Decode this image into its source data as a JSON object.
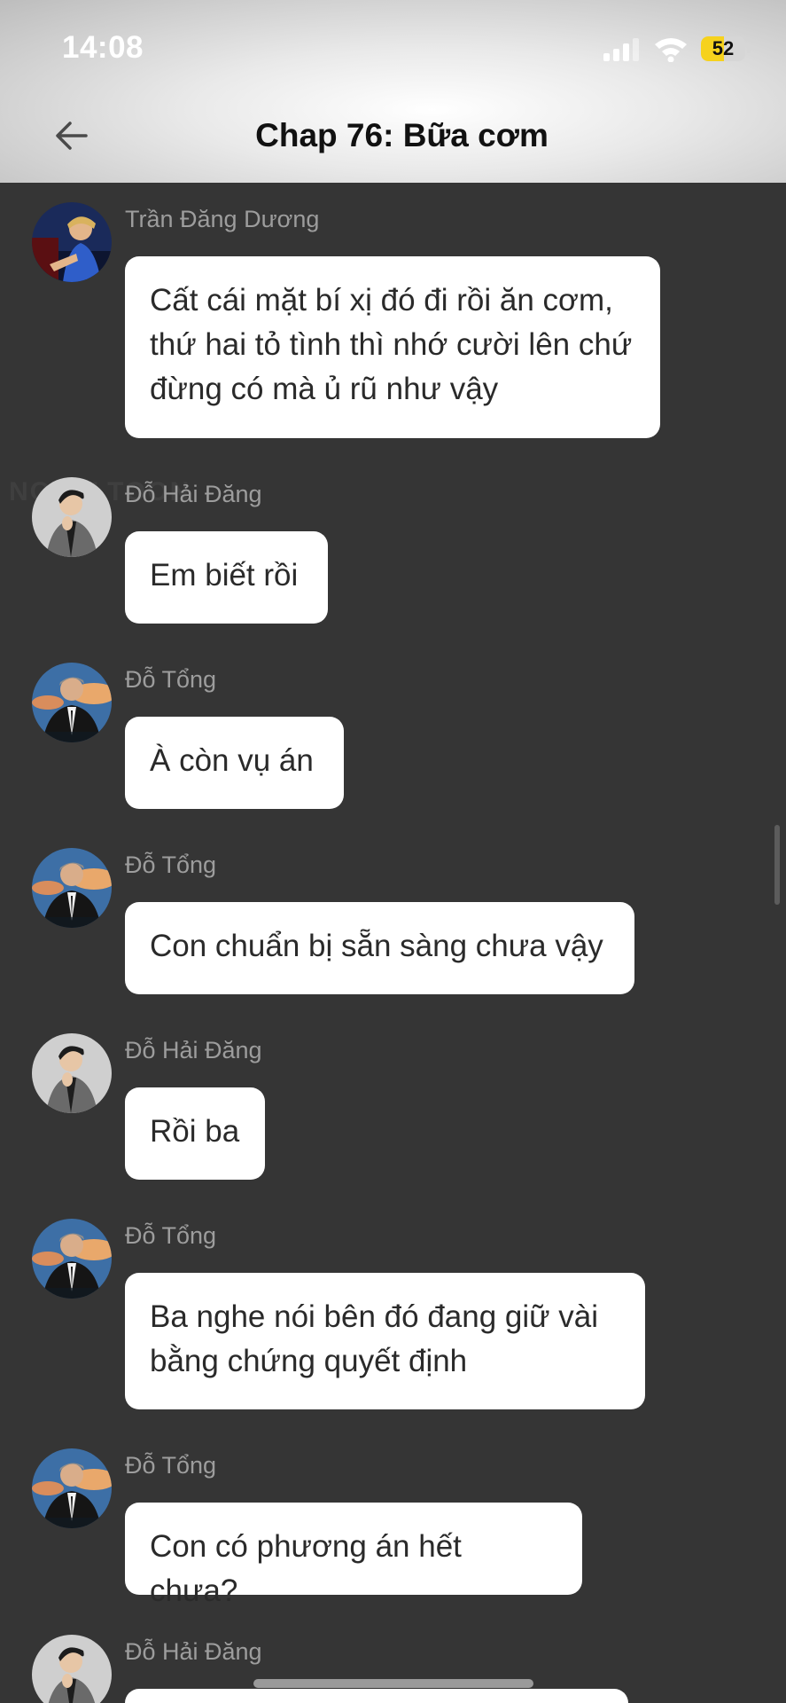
{
  "status_bar": {
    "time": "14:08",
    "battery": "52",
    "battery_level": 0.52,
    "signal_icon": "signal-bars-icon",
    "wifi_icon": "wifi-icon"
  },
  "header": {
    "back_icon": "arrow-left-icon",
    "title": "Chap 76: Bữa cơm"
  },
  "colors": {
    "background": "#353535",
    "bubble": "#ffffff",
    "sender_name": "#9d9d9d",
    "battery_accent": "#f6d21d"
  },
  "messages": [
    {
      "sender": "Trần Đăng Dương",
      "avatar": "character-duong-avatar",
      "text": "Cất cái mặt bí xị đó đi rồi ăn cơm,\nthứ hai tỏ tình thì nhớ cười lên chứ\nđừng có mà ủ rũ như vậy"
    },
    {
      "sender": "Đỗ Hải Đăng",
      "avatar": "character-dang-avatar",
      "text": "Em biết rồi"
    },
    {
      "sender": "Đỗ Tổng",
      "avatar": "character-tong-avatar",
      "text": "À còn vụ án"
    },
    {
      "sender": "Đỗ Tổng",
      "avatar": "character-tong-avatar",
      "text": "Con chuẩn bị sẵn sàng chưa vậy"
    },
    {
      "sender": "Đỗ Hải Đăng",
      "avatar": "character-dang-avatar",
      "text": "Rồi ba"
    },
    {
      "sender": "Đỗ Tổng",
      "avatar": "character-tong-avatar",
      "text": "Ba nghe nói bên đó đang giữ vài\nbằng chứng quyết định"
    },
    {
      "sender": "Đỗ Tổng",
      "avatar": "character-tong-avatar",
      "text": "Con có phương án hết chưa?"
    },
    {
      "sender": "Đỗ Hải Đăng",
      "avatar": "character-dang-avatar",
      "text": ""
    }
  ]
}
